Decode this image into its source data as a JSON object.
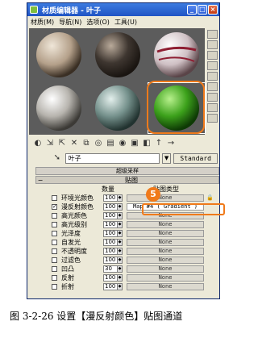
{
  "window": {
    "title": "材质编辑器 - 叶子",
    "buttons": [
      "_",
      "□",
      "×"
    ]
  },
  "menu": [
    "材质(M)",
    "导航(N)",
    "选项(O)",
    "工具(U)"
  ],
  "slots": [
    {
      "name": "tan-marble",
      "color": "#b4a08a",
      "highlight": "#efe6d8"
    },
    {
      "name": "dark-stone",
      "color": "#3e3630",
      "highlight": "#b9aa9a"
    },
    {
      "name": "striped-red",
      "color": "#cfc0c4",
      "highlight": "#ffffff"
    },
    {
      "name": "light-grey",
      "color": "#b7b4ae",
      "highlight": "#ffffff"
    },
    {
      "name": "teal-grey",
      "color": "#76928d",
      "highlight": "#e3efec"
    },
    {
      "name": "green-leaf",
      "color": "#3ca11b",
      "highlight": "#b7f08c"
    }
  ],
  "material_name": "叶子",
  "type_button": "Standard",
  "rollups": {
    "supersampling": "超级采样",
    "maps": "贴图"
  },
  "columns": {
    "amount": "数量",
    "map_type": "贴图类型"
  },
  "callout_number": "5",
  "map_rows": [
    {
      "label": "环境光颜色",
      "amount": "100",
      "map": "None",
      "checked": false,
      "active": false
    },
    {
      "label": "漫反射颜色",
      "amount": "100",
      "map": "Map #4  ( Gradient )",
      "checked": true,
      "active": true
    },
    {
      "label": "高光颜色",
      "amount": "100",
      "map": "None",
      "checked": false,
      "active": false
    },
    {
      "label": "高光级别",
      "amount": "100",
      "map": "None",
      "checked": false,
      "active": false
    },
    {
      "label": "光泽度",
      "amount": "100",
      "map": "None",
      "checked": false,
      "active": false
    },
    {
      "label": "自发光",
      "amount": "100",
      "map": "None",
      "checked": false,
      "active": false
    },
    {
      "label": "不透明度",
      "amount": "100",
      "map": "None",
      "checked": false,
      "active": false
    },
    {
      "label": "过滤色",
      "amount": "100",
      "map": "None",
      "checked": false,
      "active": false
    },
    {
      "label": "凹凸",
      "amount": "30",
      "map": "None",
      "checked": false,
      "active": false
    },
    {
      "label": "反射",
      "amount": "100",
      "map": "None",
      "checked": false,
      "active": false
    },
    {
      "label": "折射",
      "amount": "100",
      "map": "None",
      "checked": false,
      "active": false
    }
  ],
  "caption": "图 3-2-26   设置【漫反射颜色】贴图通道"
}
